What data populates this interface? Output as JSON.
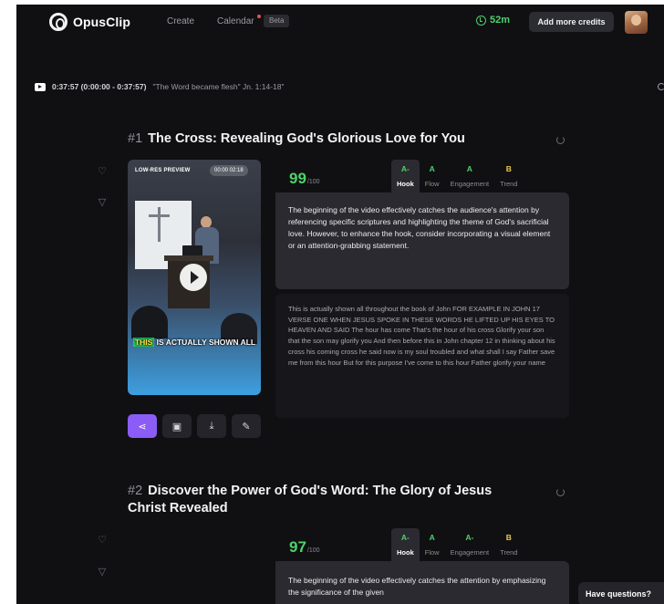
{
  "nav": {
    "brand": "OpusClip",
    "create": "Create",
    "calendar": "Calendar",
    "beta": "Beta",
    "timer": "52m",
    "credits_button": "Add more credits"
  },
  "source": {
    "range": "0:37:57 (0:00:00 - 0:37:57)",
    "title": "\"The Word became flesh\" Jn. 1:14-18\""
  },
  "clips": [
    {
      "number": "#1",
      "title": "The Cross: Revealing God's Glorious Love for You",
      "preview_label": "LOW-RES PREVIEW",
      "preview_time": "00:00 02:18",
      "caption_highlight": "THIS",
      "caption_rest": "IS ACTUALLY SHOWN ALL",
      "score": "99",
      "score_max": "/100",
      "grades": [
        {
          "value": "A-",
          "name": "Hook"
        },
        {
          "value": "A",
          "name": "Flow"
        },
        {
          "value": "A",
          "name": "Engagement"
        },
        {
          "value": "B",
          "name": "Trend"
        }
      ],
      "feedback": "The beginning of the video effectively catches the audience's attention by referencing specific scriptures and highlighting the theme of God's sacrificial love. However, to enhance the hook, consider incorporating a visual element or an attention-grabbing statement.",
      "transcript": "This is actually shown all throughout the book of John FOR EXAMPLE IN JOHN 17 VERSE ONE WHEN JESUS SPOKE IN THESE WORDS HE LIFTED UP HIS EYES TO HEAVEN AND SAID The hour has come That's the hour of his cross Glorify your son that the son may glorify you And then before this in John chapter 12 in thinking about his cross his coming cross he said now is my soul troubled and what shall I say Father save me from this hour But for this purpose I've come to this hour Father glorify your name"
    },
    {
      "number": "#2",
      "title": "Discover the Power of God's Word: The Glory of Jesus Christ Revealed",
      "score": "97",
      "score_max": "/100",
      "grades": [
        {
          "value": "A-",
          "name": "Hook"
        },
        {
          "value": "A",
          "name": "Flow"
        },
        {
          "value": "A-",
          "name": "Engagement"
        },
        {
          "value": "B",
          "name": "Trend"
        }
      ],
      "feedback": "The beginning of the video effectively catches the attention by emphasizing the significance of the given"
    }
  ],
  "help": {
    "questions_button": "Have questions?"
  },
  "colors": {
    "background": "#101013",
    "accent_green": "#4cd26b",
    "accent_purple": "#8b5cf6",
    "grade_yellow": "#f2c94c"
  },
  "icons": [
    "youtube-icon",
    "clock-icon",
    "heart-icon",
    "thumbs-down-icon",
    "refresh-icon",
    "share-icon",
    "edit-icon",
    "download-icon",
    "pencil-icon",
    "play-icon"
  ]
}
